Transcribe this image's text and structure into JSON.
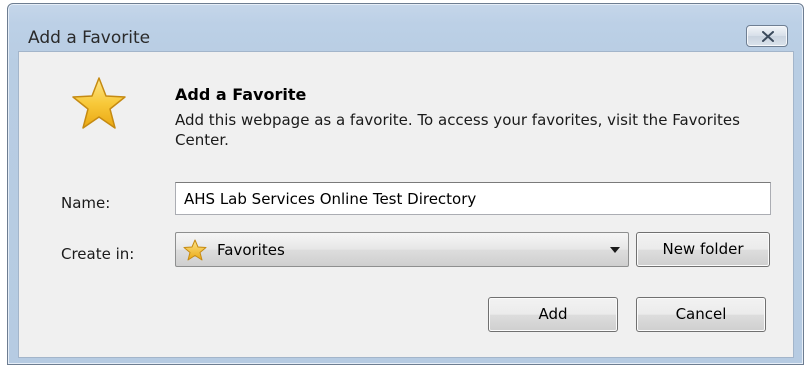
{
  "window": {
    "title": "Add a Favorite"
  },
  "dialog": {
    "heading": "Add a Favorite",
    "description": "Add this webpage as a favorite. To access your favorites, visit the Favorites Center."
  },
  "form": {
    "name_label": "Name:",
    "name_value": "AHS Lab Services Online Test Directory",
    "create_in_label": "Create in:",
    "create_in_selected": "Favorites",
    "new_folder_label": "New folder"
  },
  "buttons": {
    "add_label": "Add",
    "cancel_label": "Cancel"
  },
  "icons": {
    "header_icon": "star-icon",
    "folder_icon": "star-icon",
    "dropdown_icon": "chevron-down-icon",
    "close_icon": "close-icon"
  },
  "colors": {
    "titlebar": "#bcd0e6",
    "content_bg": "#f0f0f0",
    "star_fill": "#f5c22c"
  }
}
